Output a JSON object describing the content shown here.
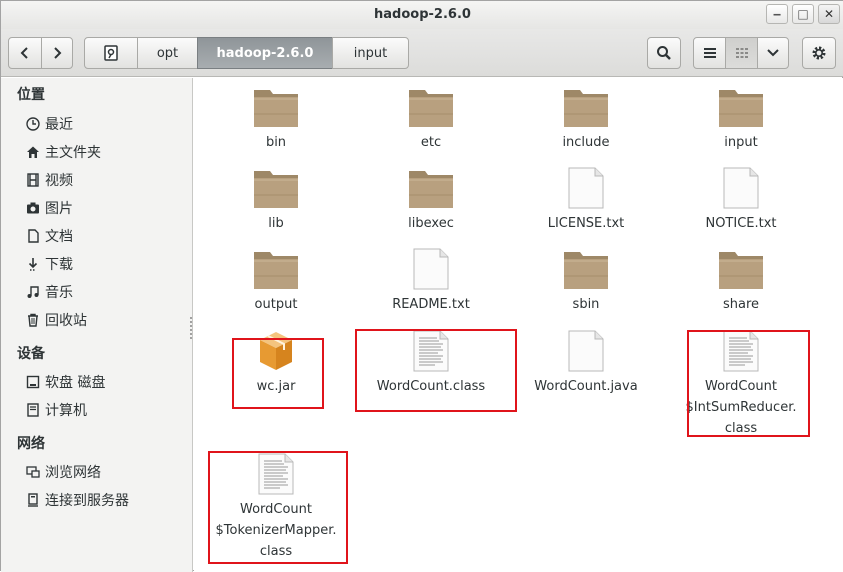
{
  "window": {
    "title": "hadoop-2.6.0",
    "wm": {
      "minimize": "‒",
      "maximize": "□",
      "close": "✕"
    }
  },
  "toolbar": {
    "path": [
      "opt",
      "hadoop-2.6.0",
      "input"
    ],
    "active_index": 1
  },
  "sidebar": {
    "sections": [
      {
        "title": "位置",
        "items": [
          {
            "label": "最近",
            "icon": "clock-icon"
          },
          {
            "label": "主文件夹",
            "icon": "home-icon"
          },
          {
            "label": "视频",
            "icon": "film-icon"
          },
          {
            "label": "图片",
            "icon": "camera-icon"
          },
          {
            "label": "文档",
            "icon": "document-icon"
          },
          {
            "label": "下载",
            "icon": "download-icon"
          },
          {
            "label": "音乐",
            "icon": "music-icon"
          },
          {
            "label": "回收站",
            "icon": "trash-icon"
          }
        ]
      },
      {
        "title": "设备",
        "items": [
          {
            "label": "软盘 磁盘",
            "icon": "drive-icon"
          },
          {
            "label": "计算机",
            "icon": "computer-icon"
          }
        ]
      },
      {
        "title": "网络",
        "items": [
          {
            "label": "浏览网络",
            "icon": "network-icon"
          },
          {
            "label": "连接到服务器",
            "icon": "server-icon"
          }
        ]
      }
    ]
  },
  "files": [
    {
      "name": "bin",
      "type": "folder"
    },
    {
      "name": "etc",
      "type": "folder"
    },
    {
      "name": "include",
      "type": "folder"
    },
    {
      "name": "input",
      "type": "folder"
    },
    {
      "name": "lib",
      "type": "folder"
    },
    {
      "name": "libexec",
      "type": "folder"
    },
    {
      "name": "LICENSE.txt",
      "type": "text"
    },
    {
      "name": "NOTICE.txt",
      "type": "text"
    },
    {
      "name": "output",
      "type": "folder"
    },
    {
      "name": "README.txt",
      "type": "text"
    },
    {
      "name": "sbin",
      "type": "folder"
    },
    {
      "name": "share",
      "type": "folder"
    },
    {
      "name": "wc.jar",
      "type": "jar"
    },
    {
      "name": "WordCount.class",
      "type": "class"
    },
    {
      "name": "WordCount.java",
      "type": "blank"
    },
    {
      "name": "WordCount\n$IntSumReducer.\nclass",
      "type": "class"
    },
    {
      "name": "WordCount\n$TokenizerMapper.\nclass",
      "type": "class"
    }
  ],
  "colors": {
    "highlight": "#e0141b",
    "folder": "#b79f7f"
  }
}
